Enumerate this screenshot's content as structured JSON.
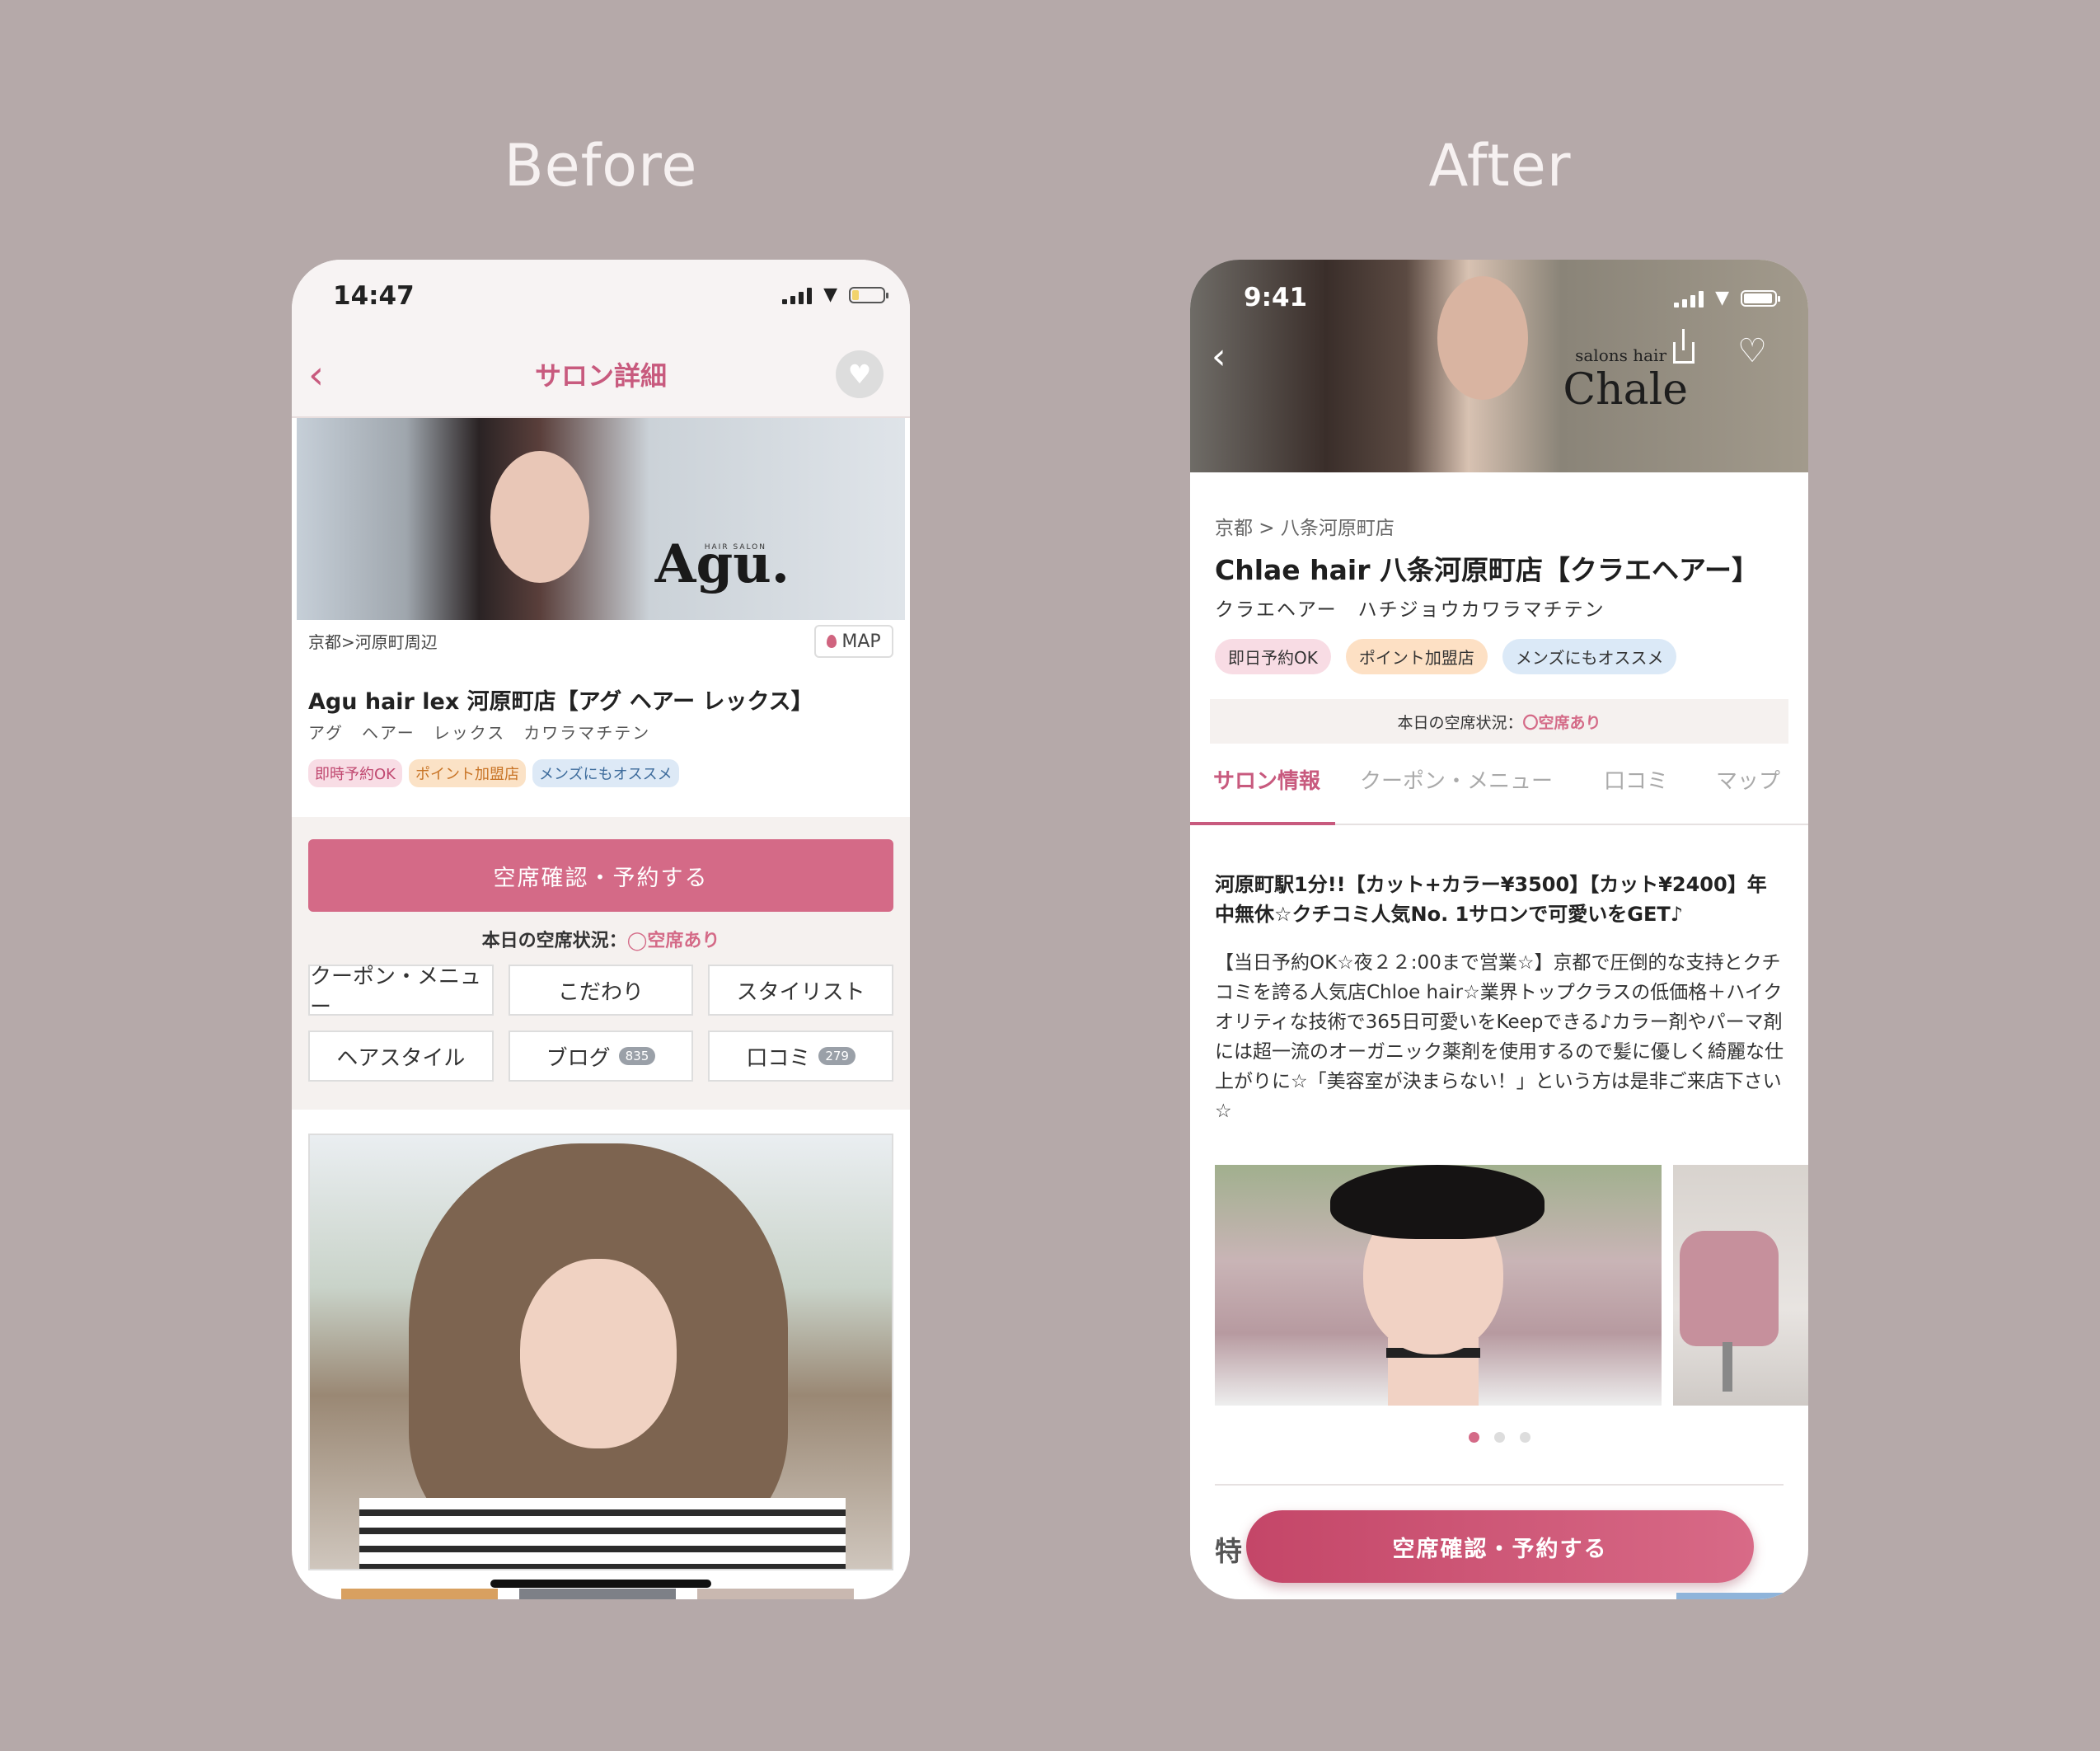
{
  "labels": {
    "before": "Before",
    "after": "After"
  },
  "before": {
    "status_time": "14:47",
    "nav": {
      "title": "サロン詳細"
    },
    "hero": {
      "logo": "Agu.",
      "logo_sub": "HAIR SALON"
    },
    "breadcrumb": "京都>河原町周辺",
    "map_button": "MAP",
    "salon_name": "Agu hair lex 河原町店【アグ ヘアー レックス】",
    "kana": "アグ　ヘアー　レックス　カワラマチテン",
    "tags": [
      "即時予約OK",
      "ポイント加盟店",
      "メンズにもオススメ"
    ],
    "reserve_button": "空席確認・予約する",
    "availability": {
      "label": "本日の空席状況：",
      "value": "空席あり"
    },
    "menu": {
      "coupon": "クーポン・メニュー",
      "kodawari": "こだわり",
      "stylist": "スタイリスト",
      "hairstyle": "ヘアスタイル",
      "blog": "ブログ",
      "blog_count": "835",
      "review": "口コミ",
      "review_count": "279"
    },
    "colors": {
      "accent": "#d46a87",
      "battery": "#f2d36b"
    }
  },
  "after": {
    "status_time": "9:41",
    "brand": {
      "sub": "salons hair",
      "name": "Chale"
    },
    "breadcrumb": "京都 > 八条河原町店",
    "salon_name": "Chlae hair 八条河原町店【クラエヘアー】",
    "kana": "クラエヘアー　ハチジョウカワラマチテン",
    "tags": [
      "即日予約OK",
      "ポイント加盟店",
      "メンズにもオススメ"
    ],
    "availability": {
      "label": "本日の空席状況：",
      "value": "〇空席あり"
    },
    "tabs": [
      "サロン情報",
      "クーポン・メニュー",
      "口コミ",
      "マップ"
    ],
    "headline": "河原町駅1分!!【カット+カラー¥3500】【カット¥2400】年中無休☆クチコミ人気No. 1サロンで可愛いをGET♪",
    "description": "【当日予約OK☆夜２２:00まで営業☆】京都で圧倒的な支持とクチコミを誇る人気店Chloe hair☆業界トップクラスの低価格＋ハイクオリティな技術で365日可愛いをKeepできる♪カラー剤やパーマ剤には超一流のオーガニック薬剤を使用するので髪に優しく綺麗な仕上がりに☆「美容室が決まらない！」という方は是非ご来店下さい☆",
    "carousel": {
      "pages": 3,
      "active": 1
    },
    "feature_heading": "特",
    "reserve_button": "空席確認・予約する",
    "colors": {
      "accent": "#c85a7e",
      "cta_start": "#c44668",
      "cta_end": "#d86a87"
    }
  }
}
